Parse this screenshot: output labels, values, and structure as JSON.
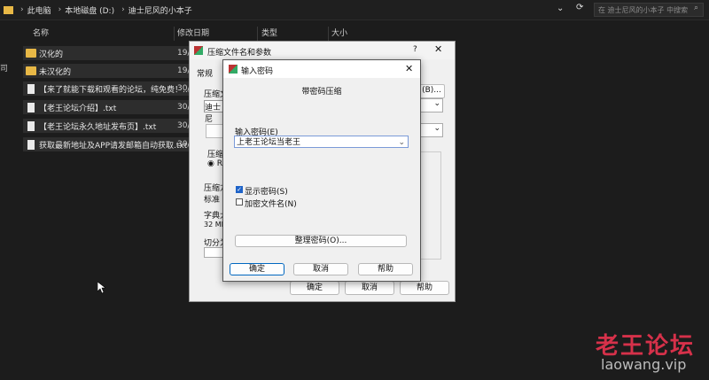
{
  "explorer": {
    "breadcrumb": [
      "此电脑",
      "本地磁盘 (D:)",
      "迪士尼风的小本子"
    ],
    "search_placeholder": "在 迪士尼风的小本子 中搜索",
    "columns": {
      "name": "名称",
      "date": "修改日期",
      "type": "类型",
      "size": "大小"
    },
    "sidebar_label": "司",
    "files": [
      {
        "name": "汉化的",
        "date": "19/",
        "kind": "folder"
      },
      {
        "name": "未汉化的",
        "date": "19/",
        "kind": "folder"
      },
      {
        "name": "【来了就能下载和观看的论坛，纯免费！...",
        "date": "30/",
        "kind": "doc"
      },
      {
        "name": "【老王论坛介绍】.txt",
        "date": "30/",
        "kind": "doc"
      },
      {
        "name": "【老王论坛永久地址发布页】.txt",
        "date": "30/",
        "kind": "doc"
      },
      {
        "name": "获取最新地址及APP请发邮箱自动获取.txt",
        "date": "30/",
        "kind": "doc"
      }
    ]
  },
  "archive_dialog": {
    "title": "压缩文件名和参数",
    "help_glyph": "?",
    "tab": "常规",
    "labels": {
      "name": "压缩文",
      "name_value": "迪士尼",
      "format": "压缩",
      "format_option": "RA",
      "method": "压缩方",
      "method_value": "标准",
      "dict": "字典大",
      "dict_value": "32 MB",
      "split": "切分为"
    },
    "browse_label": "(B)...",
    "buttons": {
      "ok": "确定",
      "cancel": "取消",
      "help": "帮助"
    }
  },
  "password_dialog": {
    "title": "输入密码",
    "heading": "带密码压缩",
    "field_label": "输入密码(E)",
    "password_value": "上老王论坛当老王",
    "show_password": {
      "label": "显示密码(S)",
      "checked": true
    },
    "encrypt_names": {
      "label": "加密文件名(N)",
      "checked": false
    },
    "organize_button": "整理密码(O)...",
    "buttons": {
      "ok": "确定",
      "cancel": "取消",
      "help": "帮助"
    }
  },
  "watermark": {
    "cn": "老王论坛",
    "url": "laowang.vip"
  },
  "colors": {
    "accent": "#0067c0",
    "folder": "#e8b846",
    "watermark": "#d6314a"
  }
}
